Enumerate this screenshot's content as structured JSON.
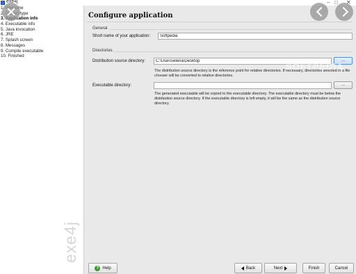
{
  "window": {
    "title": "exe4j",
    "minimize_glyph": "–",
    "maximize_glyph": "□",
    "close_glyph": "✕"
  },
  "sidebar": {
    "brand": "exe4j",
    "items": [
      {
        "label": "1. Welcome",
        "active": false
      },
      {
        "label": "2. Project type",
        "active": false
      },
      {
        "label": "3. Application info",
        "active": true
      },
      {
        "label": "4. Executable info",
        "active": false
      },
      {
        "label": "5. Java invocation",
        "active": false
      },
      {
        "label": "6. JRE",
        "active": false
      },
      {
        "label": "7. Splash screen",
        "active": false
      },
      {
        "label": "8. Messages",
        "active": false
      },
      {
        "label": "9. Compile executable",
        "active": false
      },
      {
        "label": "10. Finished",
        "active": false
      }
    ]
  },
  "main": {
    "title": "Configure application",
    "general": {
      "section_label": "General",
      "short_name_label": "Short name of your application:",
      "short_name_value": "Softpedia"
    },
    "directories": {
      "section_label": "Directories",
      "dist_label": "Distribution source directory:",
      "dist_value": "C:\\Users\\elena\\Desktop",
      "dist_browse": "...",
      "dist_help": "The distribution source directory is the reference point for relative directories. If necessary, directories selected in a file chooser will be converted to relative directories.",
      "exe_label": "Executable directory:",
      "exe_value": "",
      "exe_browse": "...",
      "exe_help": "The generated executable will be copied to the executable directory. The executable directory must be below the distribution source directory. If the executable directory is left empty, it will be the same as the distribution source directory."
    },
    "watermark": "SOFTPEDIA"
  },
  "buttons": {
    "help": "Help",
    "back": "Back",
    "next": "Next",
    "finish": "Finish",
    "cancel": "Cancel"
  },
  "icons": {
    "overlay_close": "close-icon",
    "overlay_prev": "chevron-left-icon",
    "overlay_next": "chevron-right-icon",
    "help": "help-icon"
  },
  "colors": {
    "help_icon": "#3a9a2e",
    "panel_bg": "#e9e9e9",
    "focus_accent": "#5a8ed6"
  }
}
